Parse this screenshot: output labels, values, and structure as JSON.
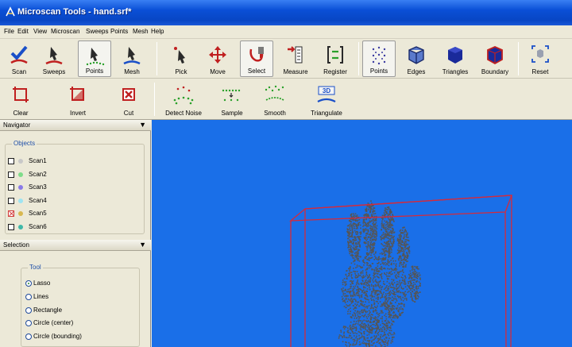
{
  "window": {
    "title": "Microscan Tools - hand.srf*"
  },
  "menu": [
    "File",
    "Edit",
    "View",
    "Microscan",
    "Sweeps",
    "Points",
    "Mesh",
    "Help"
  ],
  "toolbar_main": {
    "scan": "Scan",
    "sweeps": "Sweeps",
    "points": "Points",
    "mesh": "Mesh",
    "pick": "Pick",
    "move": "Move",
    "select": "Select",
    "measure": "Measure",
    "register": "Register",
    "points_view": "Points",
    "edges": "Edges",
    "triangles": "Triangles",
    "boundary": "Boundary",
    "reset": "Reset"
  },
  "toolbar_points": {
    "clear": "Clear",
    "invert": "Invert",
    "cut": "Cut",
    "detect_noise": "Detect Noise",
    "sample": "Sample",
    "smooth": "Smooth",
    "triangulate": "Triangulate",
    "triangulate_badge": "3D"
  },
  "navigator": {
    "header": "Navigator",
    "group_title": "Objects",
    "objects": [
      {
        "name": "Scan1",
        "color": "#c8c8c8",
        "state": "empty"
      },
      {
        "name": "Scan2",
        "color": "#7fdc8a",
        "state": "empty"
      },
      {
        "name": "Scan3",
        "color": "#8a7ae8",
        "state": "empty"
      },
      {
        "name": "Scan4",
        "color": "#9ee4f2",
        "state": "empty"
      },
      {
        "name": "Scan5",
        "color": "#d8b850",
        "state": "crossed"
      },
      {
        "name": "Scan6",
        "color": "#3fb8a8",
        "state": "empty"
      }
    ]
  },
  "selection": {
    "header": "Selection",
    "group_title": "Tool",
    "tools": [
      "Lasso",
      "Lines",
      "Rectangle",
      "Circle (center)",
      "Circle (bounding)"
    ],
    "selected": "Lasso"
  },
  "viewport": {
    "background": "#1a6fe8",
    "box_color": "#d62a3a",
    "cloud_color": "#555555"
  }
}
